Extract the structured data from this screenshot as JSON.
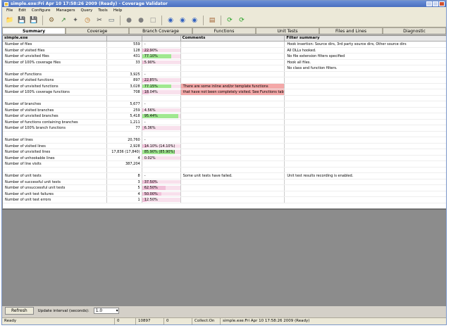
{
  "window": {
    "title": "simple.exe:Fri Apr 10 17:58:26 2009 (Ready) - Coverage Validator"
  },
  "menu": [
    "File",
    "Edit",
    "Configure",
    "Managers",
    "Query",
    "Tools",
    "Help"
  ],
  "toolbar_icons": [
    "open-icon",
    "save-icon",
    "save-as-icon",
    "settings-icon",
    "inject-icon",
    "wrench-icon",
    "clock-icon",
    "scissors-icon",
    "trash-icon",
    "record-icon",
    "stop-icon",
    "clear-icon",
    "network-icon",
    "network2-icon",
    "network3-icon",
    "manager-icon",
    "refresh-icon",
    "refresh2-icon"
  ],
  "tabs": [
    "Summary",
    "Coverage",
    "Branch Coverage",
    "Functions",
    "Unit Tests",
    "Files and Lines",
    "Diagnostic"
  ],
  "table": {
    "headers": [
      "simple.exe",
      "",
      "",
      "Comments",
      "Filter summary"
    ],
    "rows": [
      {
        "label": "Number of files",
        "value": "559",
        "pct": "-",
        "pctval": null,
        "color": "",
        "comment": "",
        "filter": "Hook insertion: Source dirs, 3rd party source dirs, Other source dirs"
      },
      {
        "label": "Number of visited files",
        "value": "128",
        "pct": "22.90%",
        "pctval": 22.9,
        "color": "p",
        "comment": "",
        "filter": "All DLLs hooked."
      },
      {
        "label": "Number of unvisited files",
        "value": "431",
        "pct": "77.10%",
        "pctval": 77.1,
        "color": "g",
        "comment": "",
        "filter": "No file extension filters specified"
      },
      {
        "label": "Number of 100% coverage files",
        "value": "33",
        "pct": "5.90%",
        "pctval": 5.9,
        "color": "p",
        "comment": "",
        "filter": "Hook all files."
      },
      {
        "label": "",
        "value": "",
        "pct": "",
        "pctval": null,
        "color": "",
        "comment": "",
        "filter": "No class and function filters."
      },
      {
        "label": "Number of Functions",
        "value": "3,925",
        "pct": "-",
        "pctval": null,
        "color": "",
        "comment": "",
        "filter": ""
      },
      {
        "label": "Number of visited functions",
        "value": "897",
        "pct": "22.85%",
        "pctval": 22.85,
        "color": "p",
        "comment": "",
        "filter": ""
      },
      {
        "label": "Number of unvisited functions",
        "value": "3,028",
        "pct": "77.15%",
        "pctval": 77.15,
        "color": "g",
        "comment": "There are some inline and/or template functions",
        "hl": true,
        "filter": ""
      },
      {
        "label": "Number of 100% coverage functions",
        "value": "708",
        "pct": "18.04%",
        "pctval": 18.04,
        "color": "p",
        "comment": "that have not been completely visited. See Functions tab.",
        "hl": true,
        "filter": ""
      },
      {
        "label": "",
        "value": "",
        "pct": "",
        "pctval": null,
        "color": "",
        "comment": "",
        "filter": ""
      },
      {
        "label": "Number of branches",
        "value": "5,677",
        "pct": "-",
        "pctval": null,
        "color": "",
        "comment": "",
        "filter": ""
      },
      {
        "label": "Number of visited branches",
        "value": "259",
        "pct": "4.56%",
        "pctval": 4.56,
        "color": "p",
        "comment": "",
        "filter": ""
      },
      {
        "label": "Number of unvisited branches",
        "value": "5,418",
        "pct": "95.44%",
        "pctval": 95.44,
        "color": "g",
        "comment": "",
        "filter": ""
      },
      {
        "label": "Number of functions containing branches",
        "value": "1,211",
        "pct": "-",
        "pctval": null,
        "color": "",
        "comment": "",
        "filter": ""
      },
      {
        "label": "Number of 100% branch functions",
        "value": "77",
        "pct": "6.36%",
        "pctval": 6.36,
        "color": "p",
        "comment": "",
        "filter": ""
      },
      {
        "label": "",
        "value": "",
        "pct": "",
        "pctval": null,
        "color": "",
        "comment": "",
        "filter": ""
      },
      {
        "label": "Number of lines",
        "value": "20,760",
        "pct": "-",
        "pctval": null,
        "color": "",
        "comment": "",
        "filter": ""
      },
      {
        "label": "Number of visited lines",
        "value": "2,928",
        "pct": "14.10% (14.10%)",
        "pctval": 14.1,
        "color": "p",
        "comment": "",
        "filter": ""
      },
      {
        "label": "Number of unvisited lines",
        "value": "17,836 (17,840)",
        "pct": "85.90% (85.90%)",
        "pctval": 85.9,
        "color": "g",
        "comment": "",
        "filter": ""
      },
      {
        "label": "Number of unhookable lines",
        "value": "4",
        "pct": "0.02%",
        "pctval": 0.02,
        "color": "p",
        "comment": "",
        "filter": ""
      },
      {
        "label": "Number of line visits",
        "value": "387,204",
        "pct": "",
        "pctval": null,
        "color": "",
        "comment": "",
        "filter": ""
      },
      {
        "label": "",
        "value": "",
        "pct": "",
        "pctval": null,
        "color": "",
        "comment": "",
        "filter": ""
      },
      {
        "label": "Number of unit tests",
        "value": "8",
        "pct": "-",
        "pctval": null,
        "color": "",
        "comment": "Some unit tests have failed.",
        "filter": "Unit test results recording is enabled."
      },
      {
        "label": "Number of successful unit tests",
        "value": "3",
        "pct": "37.50%",
        "pctval": 37.5,
        "color": "p",
        "comment": "",
        "filter": ""
      },
      {
        "label": "Number of unsuccessful unit tests",
        "value": "5",
        "pct": "62.50%",
        "pctval": 62.5,
        "color": "p",
        "comment": "",
        "filter": ""
      },
      {
        "label": "Number of unit test failures",
        "value": "4",
        "pct": "50.00%",
        "pctval": 50.0,
        "color": "p",
        "comment": "",
        "filter": ""
      },
      {
        "label": "Number of unit test errors",
        "value": "1",
        "pct": "12.50%",
        "pctval": 12.5,
        "color": "p",
        "comment": "",
        "filter": ""
      }
    ]
  },
  "bottom": {
    "refresh_label": "Refresh",
    "interval_label": "Update interval (seconds):",
    "interval_value": "1.0"
  },
  "status": {
    "ready": "Ready",
    "count1": "0",
    "count2": "10897",
    "count3": "0",
    "collect": "Collect:On",
    "session": "simple.exe:Fri Apr 10 17:58:26 2009 (Ready)"
  },
  "colors": {
    "green": "#a0e890",
    "pink": "#f0c0d8",
    "highlight": "#f4a8a8",
    "gray": "#8c8c8c"
  }
}
